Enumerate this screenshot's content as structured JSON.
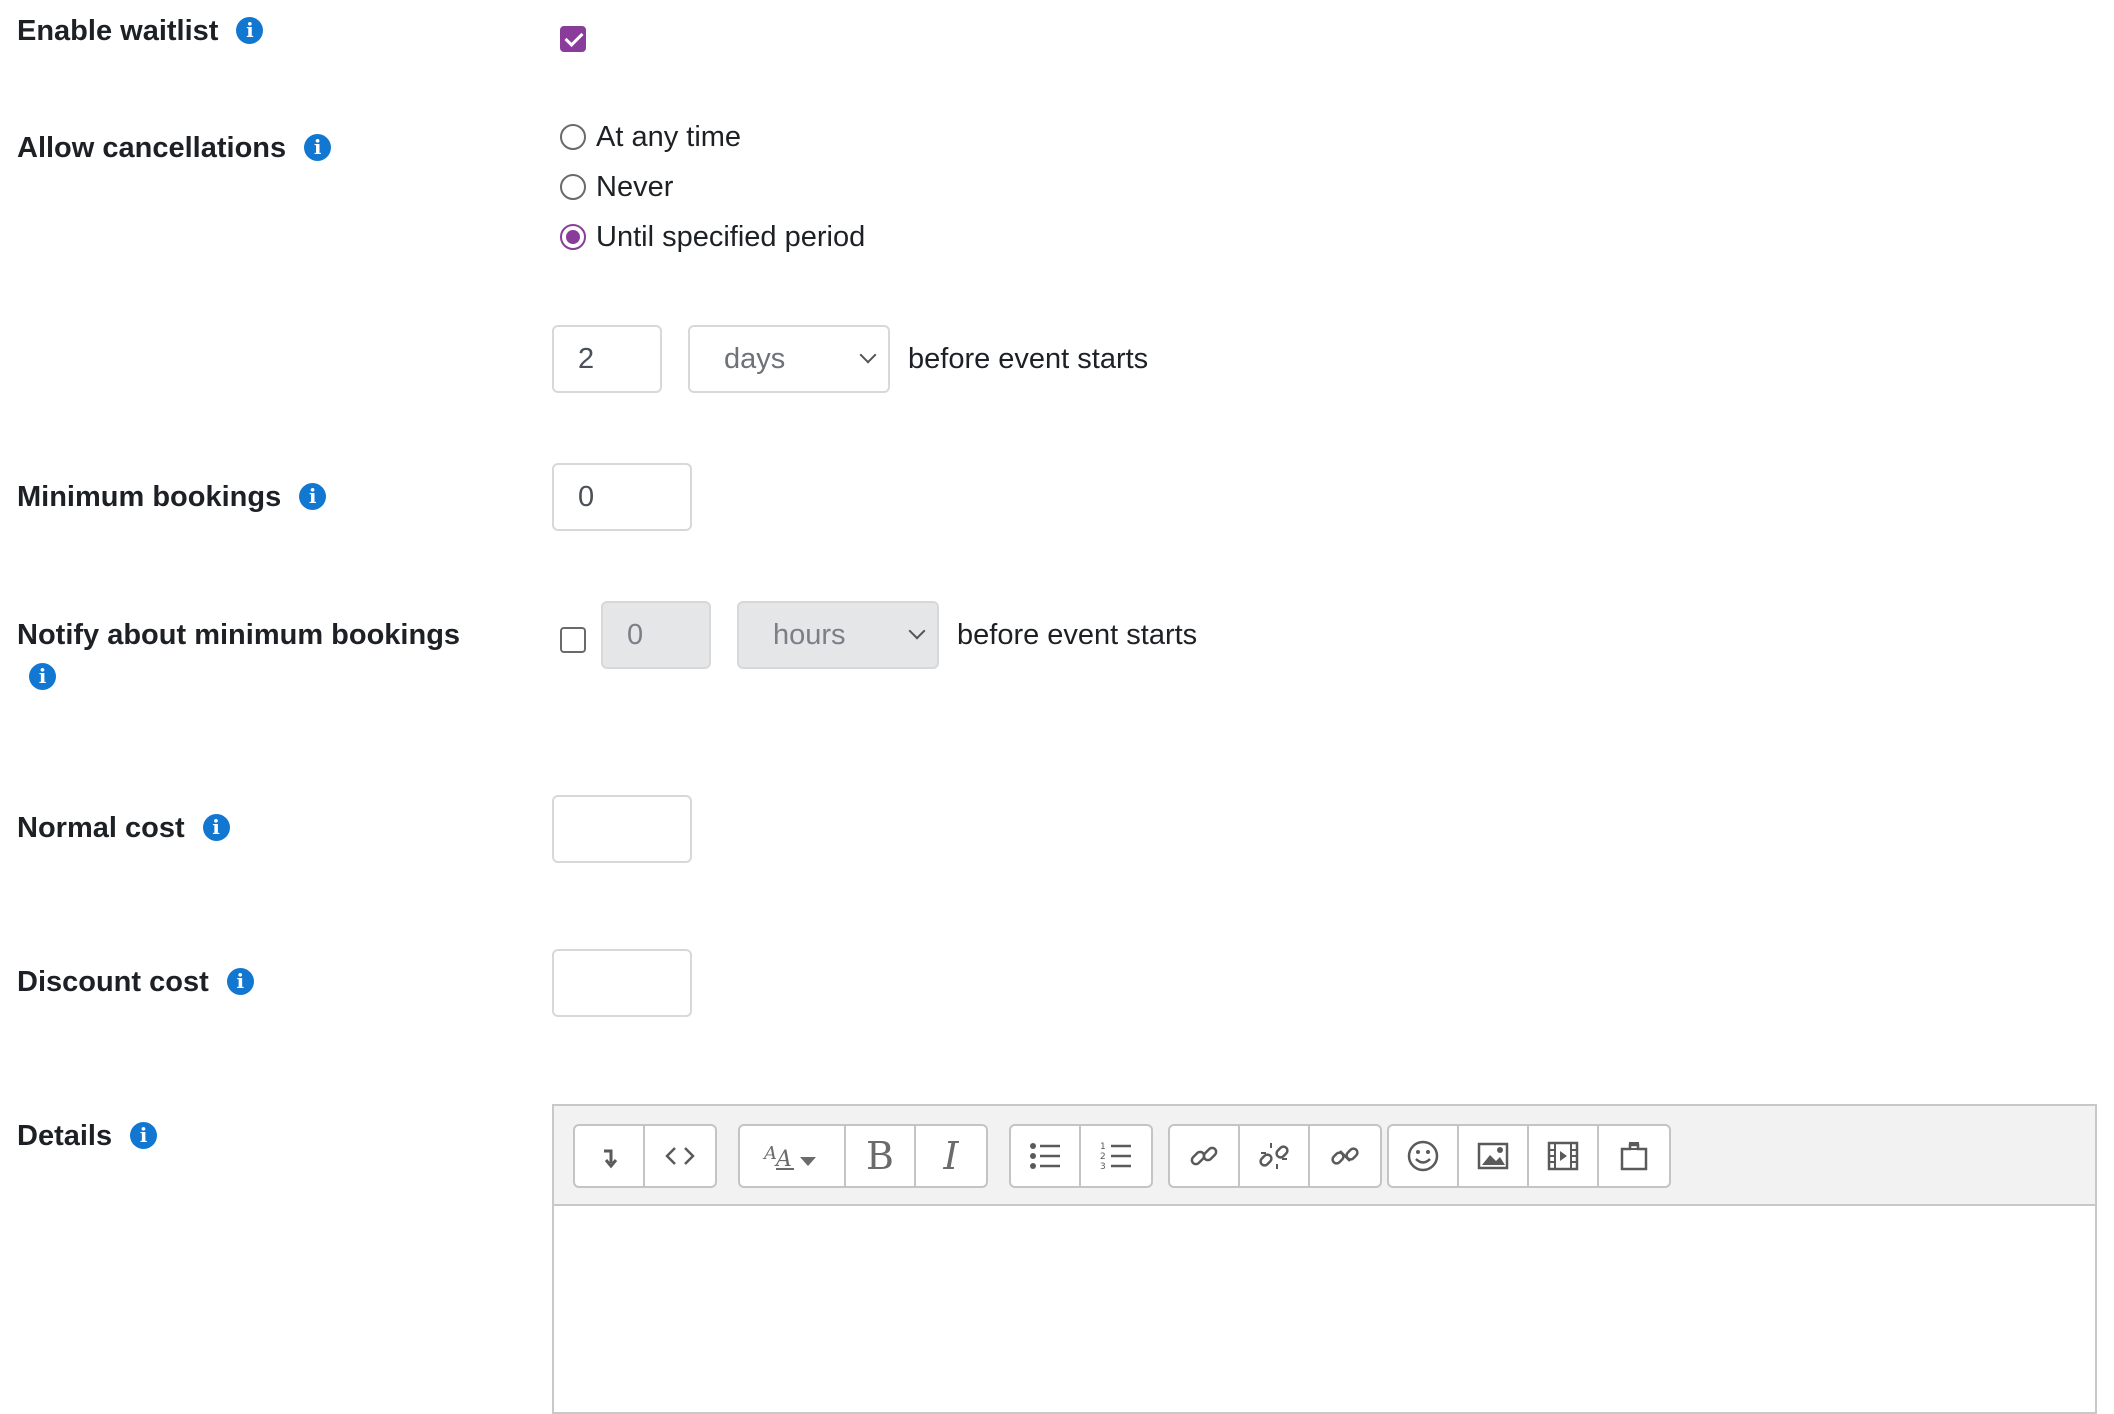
{
  "fields": {
    "enable_waitlist": {
      "label": "Enable waitlist",
      "checked": true
    },
    "allow_cancellations": {
      "label": "Allow cancellations",
      "options": [
        "At any time",
        "Never",
        "Until specified period"
      ],
      "selected": "Until specified period",
      "period_value": "2",
      "period_unit": "days",
      "suffix": "before event starts"
    },
    "minimum_bookings": {
      "label": "Minimum bookings",
      "value": "0"
    },
    "notify_minimum_bookings": {
      "label": "Notify about minimum bookings",
      "checked": false,
      "value": "0",
      "unit": "hours",
      "suffix": "before event starts"
    },
    "normal_cost": {
      "label": "Normal cost",
      "value": ""
    },
    "discount_cost": {
      "label": "Discount cost",
      "value": ""
    },
    "details": {
      "label": "Details"
    }
  },
  "info_icon_glyph": "i",
  "accent_color": "#8a3c9b",
  "info_color": "#1177d1",
  "toolbar": {
    "groups": [
      [
        "collapse-icon",
        "html-icon"
      ],
      [
        "font-size-icon",
        "bold-icon",
        "italic-icon"
      ],
      [
        "unordered-list-icon",
        "ordered-list-icon"
      ],
      [
        "link-icon",
        "unlink-icon",
        "manage-files-icon"
      ],
      [
        "emoji-icon",
        "image-icon",
        "media-icon",
        "recordrtc-icon"
      ]
    ],
    "bold_glyph": "B",
    "italic_glyph": "I"
  }
}
